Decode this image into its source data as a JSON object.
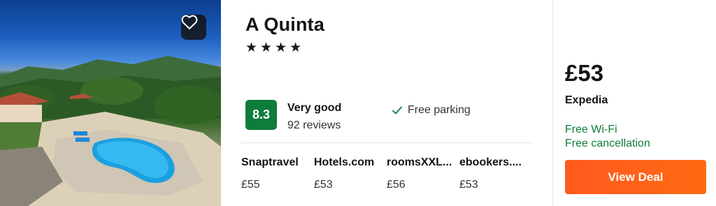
{
  "hotel": {
    "name": "A Quinta",
    "stars_text": "★★★★",
    "score": "8.3",
    "rating_label": "Very good",
    "reviews": "92 reviews",
    "amenity": "Free parking"
  },
  "providers": [
    {
      "name": "Snaptravel",
      "price": "£55"
    },
    {
      "name": "Hotels.com",
      "price": "£53"
    },
    {
      "name": "roomsXXL...",
      "price": "£56"
    },
    {
      "name": "ebookers....",
      "price": "£53"
    }
  ],
  "offer": {
    "price": "£53",
    "provider": "Expedia",
    "perks": [
      "Free Wi-Fi",
      "Free cancellation"
    ],
    "cta": "View Deal"
  },
  "icons": {
    "favorite": "heart-icon",
    "amenity": "check-icon"
  },
  "colors": {
    "score_bg": "#0e7c3a",
    "perk_text": "#0e7c3a",
    "cta_bg": "#ff5a1f"
  }
}
